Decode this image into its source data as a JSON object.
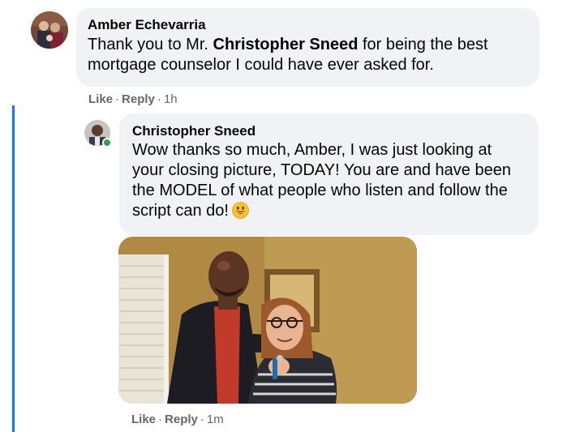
{
  "comment": {
    "author": "Amber Echevarria",
    "text_pre": "Thank you to Mr. ",
    "text_mention": "Christopher Sneed",
    "text_post": " for being the best mortgage counselor I could have ever asked for.",
    "actions": {
      "like": "Like",
      "reply": "Reply",
      "time": "1h"
    }
  },
  "reply": {
    "author": "Christopher Sneed",
    "text": "Wow thanks so much, Amber, I was just looking at your closing picture, TODAY! You are and have been the MODEL of what people who listen and follow the script can do!",
    "emoji": "grinning-face-emoji",
    "online": true,
    "actions": {
      "like": "Like",
      "reply": "Reply",
      "time": "1m"
    }
  },
  "colors": {
    "thread_line": "#1877f2",
    "bubble": "#f0f2f5",
    "meta_text": "#65676b",
    "online": "#31a24c"
  }
}
